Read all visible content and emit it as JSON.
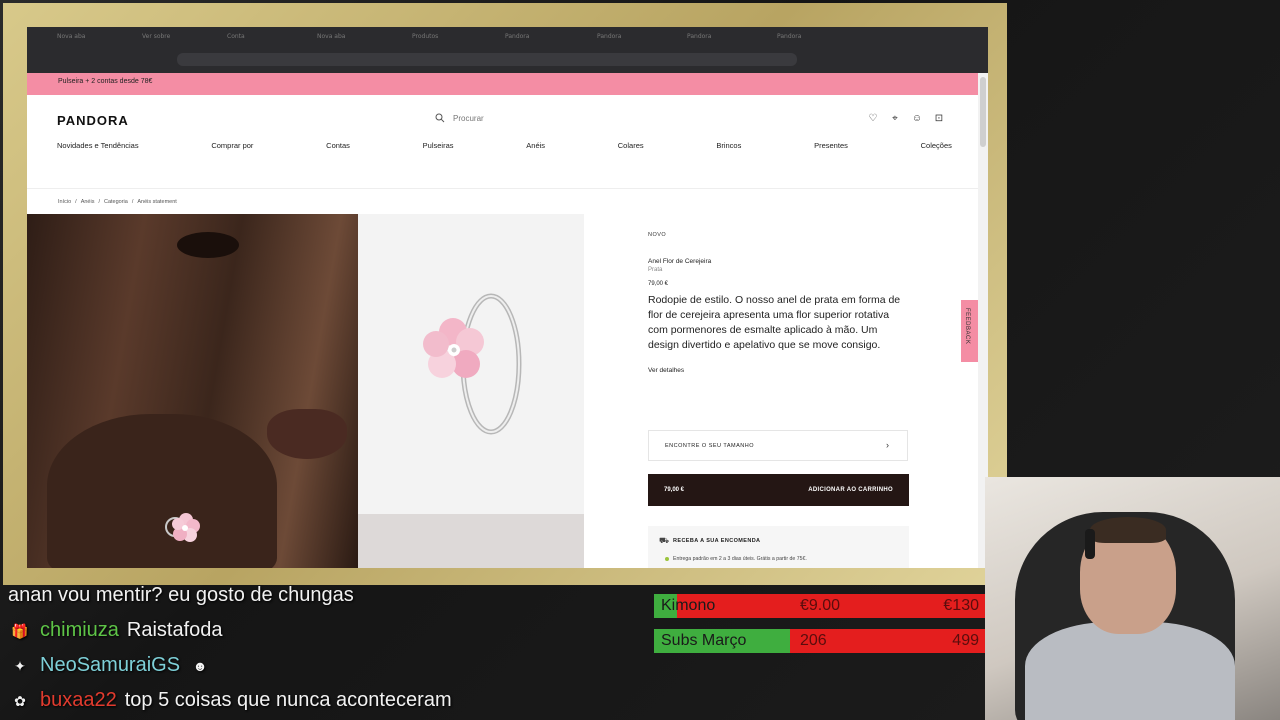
{
  "browser": {
    "tabs": [
      "Nova aba",
      "Ver sobre",
      "Conta",
      "Nova aba",
      "Produtos",
      "Pandora",
      "Pandora",
      "Pandora",
      "Pandora"
    ]
  },
  "promo": {
    "text": "Pulseira + 2 contas desde 78€"
  },
  "header": {
    "logo": "PANDORA",
    "search_placeholder": "Procurar"
  },
  "nav": [
    "Novidades e Tendências",
    "Comprar por",
    "Contas",
    "Pulseiras",
    "Anéis",
    "Colares",
    "Brincos",
    "Presentes",
    "Coleções"
  ],
  "breadcrumb": [
    "Início",
    "Anéis",
    "Categoria",
    "Anéis statement"
  ],
  "product": {
    "badge": "NOVO",
    "name": "Anel Flor de Cerejeira",
    "material": "Prata",
    "price": "79,00 €",
    "description": "Rodopie de estilo. O nosso anel de prata em forma de flor de cerejeira apresenta uma flor superior rotativa com pormenores de esmalte aplicado à mão. Um design divertido e apelativo que se move consigo.",
    "details_link": "Ver detalhes",
    "size_button": "ENCONTRE O SEU TAMANHO",
    "cart_price": "79,00 €",
    "cart_button": "ADICIONAR AO CARRINHO",
    "delivery_title": "RECEBA A SUA ENCOMENDA",
    "delivery_text": "Entrega padrão em 2 a 3 dias úteis. Grátis a partir de 75€."
  },
  "feedback": "FEEDBACK",
  "chat": [
    {
      "user": "",
      "text": "anan vou mentir? eu gosto de chungas"
    },
    {
      "user": "chimiuza",
      "text": "Raistafoda"
    },
    {
      "user": "NeoSamuraiGS",
      "text": ""
    },
    {
      "user": "buxaa22",
      "text": "top 5 coisas que nunca aconteceram"
    }
  ],
  "goals": [
    {
      "name": "Kimono",
      "current": "€9.00",
      "target": "€130",
      "progress": 0.07
    },
    {
      "name": "Subs Março",
      "current": "206",
      "target": "499",
      "progress": 0.41
    }
  ],
  "colors": {
    "promo": "#f48da4",
    "cart": "#241614",
    "goal_fill": "#3fae3f",
    "goal_bg": "#e41e1e"
  }
}
